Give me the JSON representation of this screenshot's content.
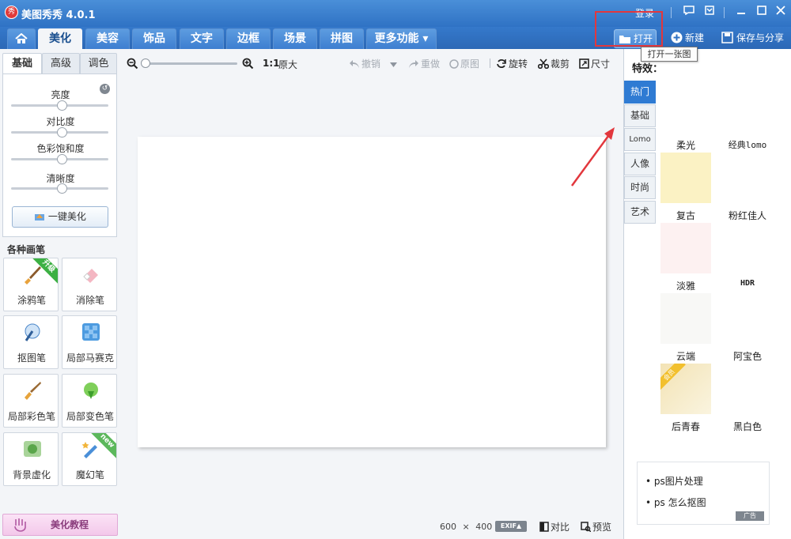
{
  "app": {
    "title": "美图秀秀 4.0.1",
    "logo_text": "秀",
    "login": "登录"
  },
  "nav": {
    "tabs": [
      {
        "label": "美化",
        "active": true
      },
      {
        "label": "美容"
      },
      {
        "label": "饰品"
      },
      {
        "label": "文字"
      },
      {
        "label": "边框"
      },
      {
        "label": "场景"
      },
      {
        "label": "拼图"
      },
      {
        "label": "更多功能 ▾"
      }
    ],
    "open_label": "打开",
    "new_label": "新建",
    "save_label": "保存与分享",
    "tooltip": "打开一张图"
  },
  "left": {
    "subtabs": [
      "基础",
      "高级",
      "调色"
    ],
    "sliders": [
      {
        "label": "亮度",
        "value": 0.5
      },
      {
        "label": "对比度",
        "value": 0.5
      },
      {
        "label": "色彩饱和度",
        "value": 0.5
      },
      {
        "label": "清晰度",
        "value": 0.5
      }
    ],
    "one_click": "一键美化",
    "brushes_title": "各种画笔",
    "brushes": [
      {
        "label": "涂鸦笔",
        "ribbon": "升级",
        "icon": "paintbrush-icon"
      },
      {
        "label": "消除笔",
        "icon": "eraser-icon"
      },
      {
        "label": "抠图笔",
        "icon": "cutout-pen-icon"
      },
      {
        "label": "局部马赛克",
        "icon": "mosaic-icon"
      },
      {
        "label": "局部彩色笔",
        "icon": "color-brush-icon"
      },
      {
        "label": "局部变色笔",
        "icon": "color-change-icon"
      },
      {
        "label": "背景虚化",
        "icon": "blur-icon"
      },
      {
        "label": "魔幻笔",
        "ribbon": "new",
        "icon": "magic-pen-icon"
      }
    ],
    "tutorial": "美化教程"
  },
  "toolbar": {
    "ratio": "1:1",
    "original_size": "原大",
    "undo": "撤销",
    "redo": "重做",
    "original": "原图",
    "rotate": "旋转",
    "crop": "裁剪",
    "size": "尺寸"
  },
  "status": {
    "width": "600",
    "times": "×",
    "height": "400",
    "exif": "EXIF▲",
    "compare": "对比",
    "preview": "预览"
  },
  "right": {
    "title": "特效：",
    "categories": [
      "热门",
      "基础",
      "Lomo",
      "人像",
      "时尚",
      "艺术"
    ],
    "effects": [
      {
        "label": "柔光",
        "color": "#fbf2c4"
      },
      {
        "label": "经典lomo",
        "color": "#ffffff"
      },
      {
        "label": "复古",
        "color": "#fdf1f1"
      },
      {
        "label": "粉红佳人",
        "color": "#ffffff"
      },
      {
        "label": "淡雅",
        "color": "#f8f8f6"
      },
      {
        "label": "HDR",
        "color": "#ffffff"
      },
      {
        "label": "云端",
        "color": "#f7eed2",
        "badge": "会员"
      },
      {
        "label": "阿宝色",
        "color": "#ffffff"
      },
      {
        "label": "后青春",
        "color": "#ffffff"
      },
      {
        "label": "黑白色",
        "color": "#ffffff"
      }
    ],
    "ads": [
      "ps图片处理",
      "ps 怎么抠图"
    ],
    "ad_badge": "广告"
  }
}
